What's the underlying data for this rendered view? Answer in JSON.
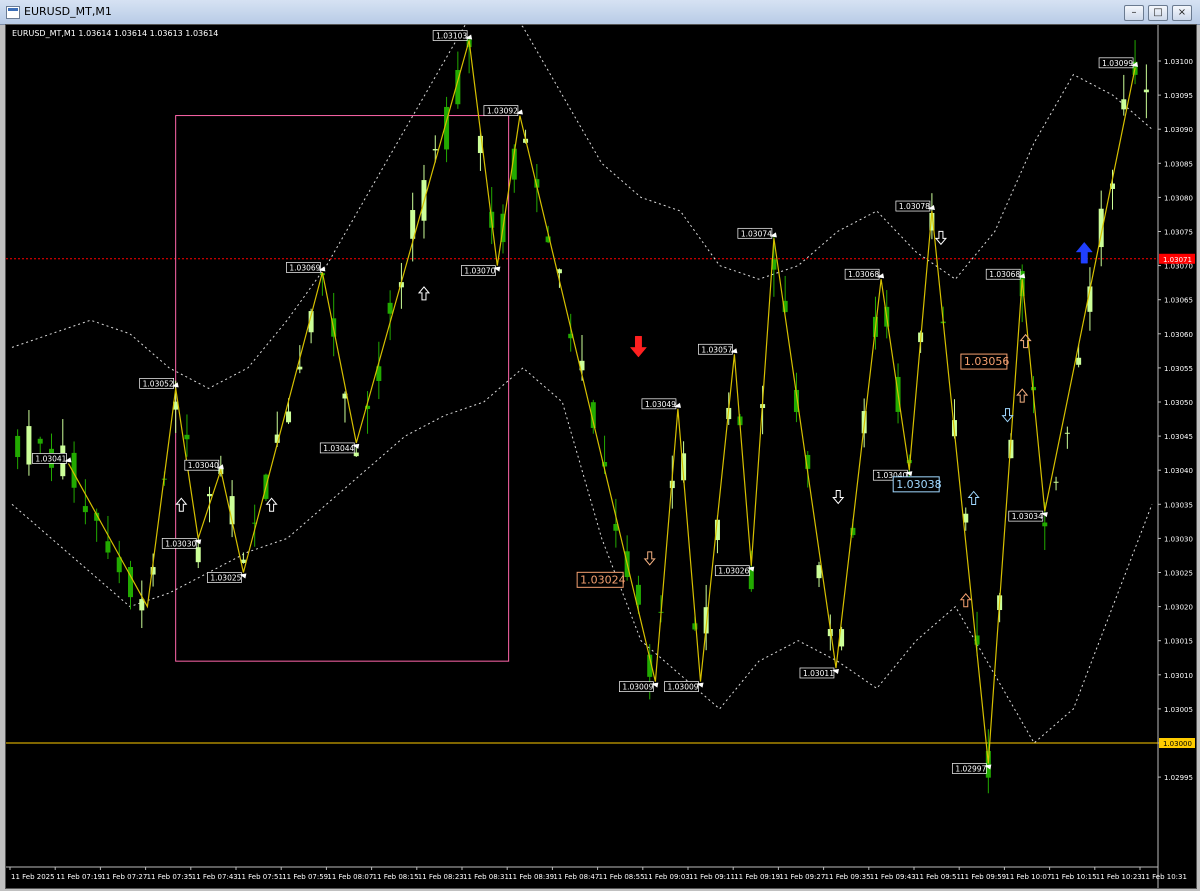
{
  "window": {
    "title": "EURUSD_MT,M1",
    "minimize_icon": "minimize-icon",
    "restore_icon": "restore-icon",
    "close_icon": "close-icon"
  },
  "chart_header": {
    "text": "EURUSD_MT,M1  1.03614 1.03614 1.03613 1.03614"
  },
  "colors": {
    "background": "#000000",
    "bull": "#ccff99",
    "bear": "#22aa00",
    "zigzag": "#d6c000",
    "bands": "#dddddd",
    "rectangle": "#ff66aa",
    "price_line": "#ff0000",
    "level_line": "#ffcc00"
  },
  "chart_data": {
    "type": "candlestick",
    "symbol": "EURUSD_MT",
    "timeframe": "M1",
    "ylim": [
      1.0299,
      1.0311
    ],
    "y_ticks": [
      "1.03100",
      "1.03095",
      "1.03090",
      "1.03085",
      "1.03080",
      "1.03075",
      "1.03070",
      "1.03065",
      "1.03060",
      "1.03055",
      "1.03050",
      "1.03045",
      "1.03040",
      "1.03035",
      "1.03030",
      "1.03025",
      "1.03020",
      "1.03015",
      "1.03010",
      "1.03005",
      "1.03000",
      "1.02995"
    ],
    "x_ticks": [
      "11 Feb 2025",
      "11 Feb 07:19",
      "11 Feb 07:27",
      "11 Feb 07:35",
      "11 Feb 07:43",
      "11 Feb 07:51",
      "11 Feb 07:59",
      "11 Feb 08:07",
      "11 Feb 08:15",
      "11 Feb 08:23",
      "11 Feb 08:31",
      "11 Feb 08:39",
      "11 Feb 08:47",
      "11 Feb 08:55",
      "11 Feb 09:03",
      "11 Feb 09:11",
      "11 Feb 09:19",
      "11 Feb 09:27",
      "11 Feb 09:35",
      "11 Feb 09:43",
      "11 Feb 09:51",
      "11 Feb 09:59",
      "11 Feb 10:07",
      "11 Feb 10:15",
      "11 Feb 10:23",
      "11 Feb 10:31"
    ],
    "current_price_label": "1.03071",
    "current_price": 1.03071,
    "level_label": "1.03000",
    "level_price": 1.03,
    "zigzag": [
      {
        "t": 5,
        "price": 1.03041,
        "label": "1.03041"
      },
      {
        "t": 12,
        "price": 1.0302,
        "label": ""
      },
      {
        "t": 14.5,
        "price": 1.03052,
        "label": "1.03052"
      },
      {
        "t": 16.5,
        "price": 1.0303,
        "label": "1.03030"
      },
      {
        "t": 18.5,
        "price": 1.0304,
        "label": "1.03040"
      },
      {
        "t": 20.5,
        "price": 1.03025,
        "label": "1.03025"
      },
      {
        "t": 27.5,
        "price": 1.03069,
        "label": "1.03069"
      },
      {
        "t": 30.5,
        "price": 1.03044,
        "label": "1.03044"
      },
      {
        "t": 40.5,
        "price": 1.03103,
        "label": "1.03103"
      },
      {
        "t": 43,
        "price": 1.0307,
        "label": "1.03070"
      },
      {
        "t": 45,
        "price": 1.03092,
        "label": "1.03092"
      },
      {
        "t": 57,
        "price": 1.03009,
        "label": "1.03009"
      },
      {
        "t": 59,
        "price": 1.03049,
        "label": "1.03049"
      },
      {
        "t": 61,
        "price": 1.03009,
        "label": "1.03009"
      },
      {
        "t": 64,
        "price": 1.03057,
        "label": "1.03057"
      },
      {
        "t": 65.5,
        "price": 1.03026,
        "label": "1.03026"
      },
      {
        "t": 67.5,
        "price": 1.03074,
        "label": "1.03074"
      },
      {
        "t": 73,
        "price": 1.03011,
        "label": "1.03011"
      },
      {
        "t": 77,
        "price": 1.03068,
        "label": "1.03068"
      },
      {
        "t": 79.5,
        "price": 1.0304,
        "label": "1.03040"
      },
      {
        "t": 81.5,
        "price": 1.03078,
        "label": "1.03078"
      },
      {
        "t": 86.5,
        "price": 1.02997,
        "label": "1.02997"
      },
      {
        "t": 89.5,
        "price": 1.03068,
        "label": "1.03068"
      },
      {
        "t": 91.5,
        "price": 1.03034,
        "label": "1.03034"
      },
      {
        "t": 99.5,
        "price": 1.03099,
        "label": "1.03099"
      }
    ],
    "big_labels": [
      {
        "t": 54.5,
        "price": 1.03024,
        "text": "1.03024",
        "color": "#f4a070"
      },
      {
        "t": 82.5,
        "price": 1.03038,
        "text": "1.03038",
        "color": "#a0d8ff"
      },
      {
        "t": 88.5,
        "price": 1.03056,
        "text": "1.03056",
        "color": "#f4a070"
      }
    ],
    "rectangle": {
      "t0": 14.5,
      "t1": 44,
      "p0": 1.03092,
      "p1": 1.03012
    },
    "bands": {
      "upper": [
        1.03058,
        1.0306,
        1.03062,
        1.0306,
        1.03055,
        1.03052,
        1.03055,
        1.03062,
        1.0307,
        1.0308,
        1.0309,
        1.031,
        1.0311,
        1.03105,
        1.03095,
        1.03085,
        1.0308,
        1.03078,
        1.0307,
        1.03068,
        1.0307,
        1.03075,
        1.03078,
        1.03072,
        1.03068,
        1.03075,
        1.03088,
        1.03098,
        1.03095,
        1.0309
      ],
      "lower": [
        1.03035,
        1.0303,
        1.03025,
        1.0302,
        1.03022,
        1.03025,
        1.03028,
        1.0303,
        1.03035,
        1.0304,
        1.03045,
        1.03048,
        1.0305,
        1.03055,
        1.0305,
        1.0303,
        1.03015,
        1.0301,
        1.03005,
        1.03012,
        1.03015,
        1.03012,
        1.03008,
        1.03015,
        1.0302,
        1.0301,
        1.03,
        1.03005,
        1.0302,
        1.03035
      ]
    },
    "arrows": [
      {
        "t": 55.5,
        "price": 1.03058,
        "dir": "down",
        "color": "#ff2020",
        "big": true
      },
      {
        "t": 95,
        "price": 1.03072,
        "dir": "up",
        "color": "#2040ff",
        "big": true
      },
      {
        "t": 56.5,
        "price": 1.03027,
        "dir": "down",
        "color": "#f4b080",
        "big": false
      },
      {
        "t": 84.5,
        "price": 1.03021,
        "dir": "up",
        "color": "#f4a070",
        "big": false
      },
      {
        "t": 88.2,
        "price": 1.03048,
        "dir": "down",
        "color": "#a0d8ff",
        "big": false
      },
      {
        "t": 89.5,
        "price": 1.03051,
        "dir": "up",
        "color": "#f4b080",
        "big": false
      },
      {
        "t": 89.8,
        "price": 1.03059,
        "dir": "up",
        "color": "#f4b080",
        "big": false
      },
      {
        "t": 85.2,
        "price": 1.03036,
        "dir": "up",
        "color": "#a0d8ff",
        "big": false
      },
      {
        "t": 15,
        "price": 1.03035,
        "dir": "up",
        "color": "#ffffff",
        "big": false
      },
      {
        "t": 23,
        "price": 1.03035,
        "dir": "up",
        "color": "#ffffff",
        "big": false
      },
      {
        "t": 36.5,
        "price": 1.03066,
        "dir": "up",
        "color": "#ffffff",
        "big": false
      },
      {
        "t": 73.2,
        "price": 1.03036,
        "dir": "down",
        "color": "#ffffff",
        "big": false
      },
      {
        "t": 82.3,
        "price": 1.03074,
        "dir": "down",
        "color": "#ffffff",
        "big": false
      }
    ]
  }
}
